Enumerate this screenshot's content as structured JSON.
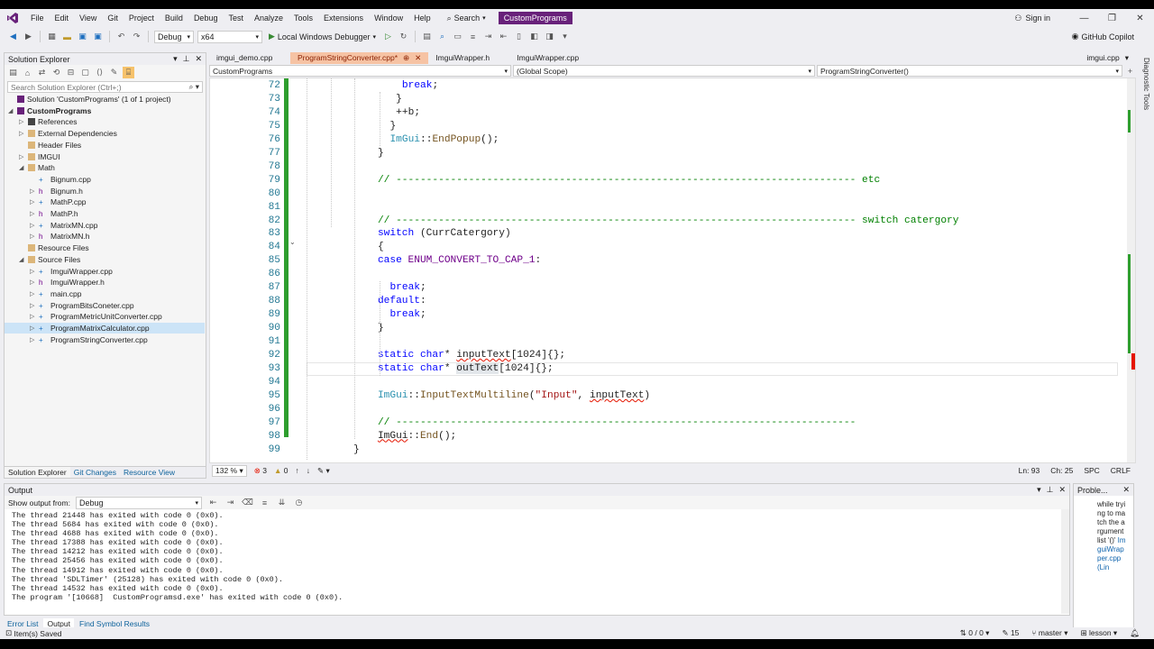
{
  "menu": [
    "File",
    "Edit",
    "View",
    "Git",
    "Project",
    "Build",
    "Debug",
    "Test",
    "Analyze",
    "Tools",
    "Extensions",
    "Window",
    "Help"
  ],
  "search_label": "Search",
  "solution_name": "CustomPrograms",
  "sign_in": "Sign in",
  "toolbar": {
    "config": "Debug",
    "platform": "x64",
    "run_label": "Local Windows Debugger",
    "copilot": "GitHub Copilot"
  },
  "solution_explorer": {
    "title": "Solution Explorer",
    "search_placeholder": "Search Solution Explorer (Ctrl+;)",
    "nodes": [
      {
        "label": "Solution 'CustomPrograms' (1 of 1 project)",
        "depth": 0,
        "arrow": "",
        "icon": "solution"
      },
      {
        "label": "CustomPrograms",
        "depth": 0,
        "arrow": "open",
        "icon": "project",
        "bold": true
      },
      {
        "label": "References",
        "depth": 1,
        "arrow": "closed",
        "icon": "ref"
      },
      {
        "label": "External Dependencies",
        "depth": 1,
        "arrow": "closed",
        "icon": "folder"
      },
      {
        "label": "Header Files",
        "depth": 1,
        "arrow": "",
        "icon": "folder"
      },
      {
        "label": "IMGUI",
        "depth": 1,
        "arrow": "closed",
        "icon": "folder"
      },
      {
        "label": "Math",
        "depth": 1,
        "arrow": "open",
        "icon": "folder"
      },
      {
        "label": "Bignum.cpp",
        "depth": 2,
        "arrow": "",
        "icon": "cpp"
      },
      {
        "label": "Bignum.h",
        "depth": 2,
        "arrow": "closed",
        "icon": "h"
      },
      {
        "label": "MathP.cpp",
        "depth": 2,
        "arrow": "closed",
        "icon": "cpp"
      },
      {
        "label": "MathP.h",
        "depth": 2,
        "arrow": "closed",
        "icon": "h"
      },
      {
        "label": "MatrixMN.cpp",
        "depth": 2,
        "arrow": "closed",
        "icon": "cpp"
      },
      {
        "label": "MatrixMN.h",
        "depth": 2,
        "arrow": "closed",
        "icon": "h"
      },
      {
        "label": "Resource Files",
        "depth": 1,
        "arrow": "",
        "icon": "folder"
      },
      {
        "label": "Source Files",
        "depth": 1,
        "arrow": "open",
        "icon": "folder"
      },
      {
        "label": "ImguiWrapper.cpp",
        "depth": 2,
        "arrow": "closed",
        "icon": "cpp"
      },
      {
        "label": "ImguiWrapper.h",
        "depth": 2,
        "arrow": "closed",
        "icon": "h"
      },
      {
        "label": "main.cpp",
        "depth": 2,
        "arrow": "closed",
        "icon": "cpp"
      },
      {
        "label": "ProgramBitsConeter.cpp",
        "depth": 2,
        "arrow": "closed",
        "icon": "cpp"
      },
      {
        "label": "ProgramMetricUnitConverter.cpp",
        "depth": 2,
        "arrow": "closed",
        "icon": "cpp"
      },
      {
        "label": "ProgramMatrixCalculator.cpp",
        "depth": 2,
        "arrow": "closed",
        "icon": "cpp",
        "selected": true
      },
      {
        "label": "ProgramStringConverter.cpp",
        "depth": 2,
        "arrow": "closed",
        "icon": "cpp"
      }
    ],
    "tabs": [
      "Solution Explorer",
      "Git Changes",
      "Resource View"
    ]
  },
  "doc_tabs": [
    "imgui_demo.cpp",
    "ProgramStringConverter.cpp*",
    "ImguiWrapper.h",
    "ImguiWrapper.cpp"
  ],
  "doc_tab_right": "imgui.cpp",
  "nav": {
    "project": "CustomPrograms",
    "scope": "(Global Scope)",
    "member": "ProgramStringConverter()"
  },
  "code_lines": [
    {
      "n": "72",
      "indent": 8,
      "parts": [
        [
          "kw",
          "break"
        ],
        [
          "nm",
          ";"
        ]
      ]
    },
    {
      "n": "73",
      "indent": 7,
      "parts": [
        [
          "nm",
          "}"
        ]
      ]
    },
    {
      "n": "74",
      "indent": 7,
      "parts": [
        [
          "nm",
          "++b;"
        ]
      ]
    },
    {
      "n": "75",
      "indent": 6,
      "parts": [
        [
          "nm",
          "}"
        ]
      ]
    },
    {
      "n": "76",
      "indent": 6,
      "parts": [
        [
          "ty",
          "ImGui"
        ],
        [
          "nm",
          "::"
        ],
        [
          "fn",
          "EndPopup"
        ],
        [
          "nm",
          "();"
        ]
      ]
    },
    {
      "n": "77",
      "indent": 4,
      "parts": [
        [
          "nm",
          "}"
        ]
      ]
    },
    {
      "n": "78",
      "indent": 0,
      "parts": []
    },
    {
      "n": "79",
      "indent": 4,
      "parts": [
        [
          "cm",
          "// ---------------------------------------------------------------------------- etc"
        ]
      ]
    },
    {
      "n": "80",
      "indent": 0,
      "parts": []
    },
    {
      "n": "81",
      "indent": 0,
      "parts": []
    },
    {
      "n": "82",
      "indent": 4,
      "parts": [
        [
          "cm",
          "// ---------------------------------------------------------------------------- switch catergory"
        ]
      ]
    },
    {
      "n": "83",
      "indent": 4,
      "parts": [
        [
          "kw",
          "switch"
        ],
        [
          "nm",
          " (CurrCatergory)"
        ]
      ]
    },
    {
      "n": "84",
      "indent": 4,
      "parts": [
        [
          "nm",
          "{"
        ]
      ]
    },
    {
      "n": "85",
      "indent": 4,
      "parts": [
        [
          "kw",
          "case"
        ],
        [
          "nm",
          " "
        ],
        [
          "mc",
          "ENUM_CONVERT_TO_CAP_1"
        ],
        [
          "nm",
          ":"
        ]
      ]
    },
    {
      "n": "86",
      "indent": 0,
      "parts": []
    },
    {
      "n": "87",
      "indent": 6,
      "parts": [
        [
          "kw",
          "break"
        ],
        [
          "nm",
          ";"
        ]
      ]
    },
    {
      "n": "88",
      "indent": 4,
      "parts": [
        [
          "kw",
          "default"
        ],
        [
          "nm",
          ":"
        ]
      ]
    },
    {
      "n": "89",
      "indent": 6,
      "parts": [
        [
          "kw",
          "break"
        ],
        [
          "nm",
          ";"
        ]
      ]
    },
    {
      "n": "90",
      "indent": 4,
      "parts": [
        [
          "nm",
          "}"
        ]
      ]
    },
    {
      "n": "91",
      "indent": 0,
      "parts": []
    },
    {
      "n": "92",
      "indent": 4,
      "parts": [
        [
          "kw",
          "static"
        ],
        [
          "nm",
          " "
        ],
        [
          "kw",
          "char"
        ],
        [
          "nm",
          "* "
        ],
        [
          "err",
          "inputText"
        ],
        [
          "nm",
          "[1024]{};"
        ]
      ]
    },
    {
      "n": "93",
      "indent": 4,
      "parts": [
        [
          "kw",
          "static"
        ],
        [
          "nm",
          " "
        ],
        [
          "kw",
          "char"
        ],
        [
          "nm",
          "* "
        ],
        [
          "nm",
          "outText"
        ],
        [
          "nm",
          "[1024]{};"
        ]
      ]
    },
    {
      "n": "94",
      "indent": 0,
      "parts": []
    },
    {
      "n": "95",
      "indent": 4,
      "parts": [
        [
          "ty",
          "ImGui"
        ],
        [
          "nm",
          "::"
        ],
        [
          "fn",
          "InputTextMultiline"
        ],
        [
          "nm",
          "("
        ],
        [
          "str",
          "\"Input\""
        ],
        [
          "nm",
          ", "
        ],
        [
          "err",
          "inputText"
        ],
        [
          "nm",
          ")"
        ]
      ]
    },
    {
      "n": "96",
      "indent": 0,
      "parts": []
    },
    {
      "n": "97",
      "indent": 4,
      "parts": [
        [
          "cm",
          "// ----------------------------------------------------------------------------"
        ]
      ]
    },
    {
      "n": "98",
      "indent": 4,
      "parts": [
        [
          "err",
          "ImGui"
        ],
        [
          "nm",
          "::"
        ],
        [
          "fn",
          "End"
        ],
        [
          "nm",
          "();"
        ]
      ]
    },
    {
      "n": "99",
      "indent": 0,
      "parts": [
        [
          "nm",
          "}"
        ]
      ]
    }
  ],
  "editor_status": {
    "zoom": "132 %",
    "errors": "3",
    "warnings": "0",
    "ln": "Ln: 93",
    "ch": "Ch: 25",
    "enc": "SPC",
    "eol": "CRLF"
  },
  "output": {
    "title": "Output",
    "show_from_label": "Show output from:",
    "source": "Debug",
    "lines": [
      "The thread 21448 has exited with code 0 (0x0).",
      "The thread 5684 has exited with code 0 (0x0).",
      "The thread 4688 has exited with code 0 (0x0).",
      "The thread 17388 has exited with code 0 (0x0).",
      "The thread 14212 has exited with code 0 (0x0).",
      "The thread 25456 has exited with code 0 (0x0).",
      "The thread 14912 has exited with code 0 (0x0).",
      "The thread 'SDLTimer' (25128) has exited with code 0 (0x0).",
      "The thread 14532 has exited with code 0 (0x0).",
      "The program '[10668]  CustomProgramsd.exe' has exited with code 0 (0x0)."
    ]
  },
  "problems": {
    "title": "Proble...",
    "text": "while trying to match the argument list '()'",
    "link": "ImguiWrapper.cpp (Lin"
  },
  "bottom_tabs": [
    "Error List",
    "Output",
    "Find Symbol Results"
  ],
  "status": {
    "left": "Item(s) Saved",
    "changes": "0 / 0",
    "edits": "15",
    "branch": "master",
    "repo": "lesson"
  },
  "diagnostic_tools": "Diagnostic Tools"
}
